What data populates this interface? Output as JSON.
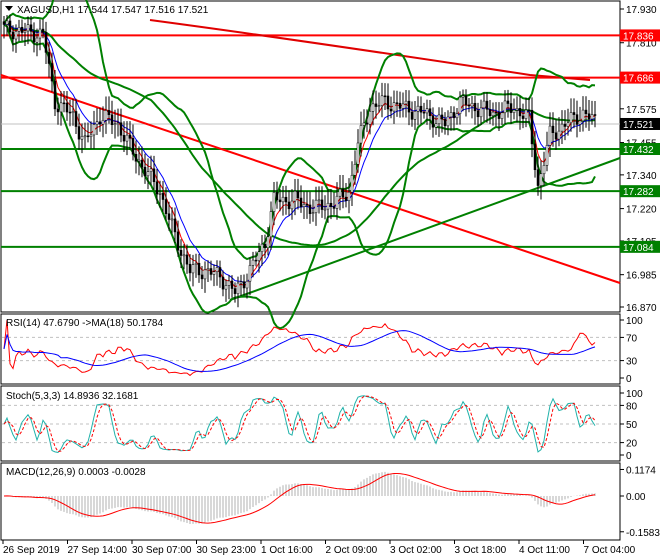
{
  "header": {
    "symbol": "XAGUSD,H1",
    "open": "17.544",
    "high": "17.547",
    "low": "17.516",
    "close": "17.521"
  },
  "chart_data": {
    "type": "candlestick",
    "title": "XAGUSD,H1",
    "price_axis": {
      "ticks": [
        "17.930",
        "17.810",
        "17.575",
        "17.455",
        "17.340",
        "17.220",
        "17.105",
        "16.985",
        "16.870"
      ],
      "range": [
        16.87,
        17.93
      ]
    },
    "current_price": "17.521",
    "levels": [
      {
        "value": "17.836",
        "color": "#ff0000"
      },
      {
        "value": "17.686",
        "color": "#ff0000"
      },
      {
        "value": "17.432",
        "color": "#008000"
      },
      {
        "value": "17.282",
        "color": "#008000"
      },
      {
        "value": "17.084",
        "color": "#008000"
      }
    ],
    "close_keypoints": [
      [
        0,
        17.86
      ],
      [
        13,
        17.84
      ],
      [
        17,
        17.6
      ],
      [
        23,
        17.55
      ],
      [
        27,
        17.45
      ],
      [
        32,
        17.55
      ],
      [
        38,
        17.52
      ],
      [
        43,
        17.42
      ],
      [
        52,
        17.28
      ],
      [
        57,
        17.12
      ],
      [
        62,
        17.0
      ],
      [
        67,
        17.0
      ],
      [
        72,
        16.98
      ],
      [
        77,
        16.92
      ],
      [
        82,
        17.0
      ],
      [
        87,
        17.1
      ],
      [
        90,
        17.25
      ],
      [
        97,
        17.25
      ],
      [
        103,
        17.22
      ],
      [
        110,
        17.24
      ],
      [
        115,
        17.28
      ],
      [
        118,
        17.45
      ],
      [
        122,
        17.58
      ],
      [
        127,
        17.6
      ],
      [
        133,
        17.58
      ],
      [
        140,
        17.56
      ],
      [
        147,
        17.52
      ],
      [
        152,
        17.6
      ],
      [
        157,
        17.58
      ],
      [
        163,
        17.56
      ],
      [
        170,
        17.58
      ],
      [
        175,
        17.54
      ],
      [
        178,
        17.3
      ],
      [
        182,
        17.48
      ],
      [
        187,
        17.52
      ],
      [
        193,
        17.56
      ],
      [
        197,
        17.53
      ]
    ],
    "x_ticks": [
      "26 Sep 2019",
      "27 Sep 14:00",
      "30 Sep 07:00",
      "30 Sep 23:00",
      "1 Oct 16:00",
      "2 Oct 09:00",
      "3 Oct 02:00",
      "3 Oct 18:00",
      "4 Oct 11:00",
      "7 Oct 04:00"
    ],
    "indicators": {
      "rsi": {
        "label": "RSI(14) 47.6790  ->MA(18) 50.1784",
        "ticks": [
          "100",
          "70",
          "30",
          "0"
        ]
      },
      "stoch": {
        "label": "Stoch(5,3,3) 14.8936 32.1681",
        "ticks": [
          "100",
          "80",
          "50",
          "20",
          "0"
        ]
      },
      "macd": {
        "label": "MACD(12,26,9) 0.0003 -0.0028",
        "ticks": [
          "0.1174",
          "0.00",
          "-0.1583"
        ]
      }
    }
  }
}
